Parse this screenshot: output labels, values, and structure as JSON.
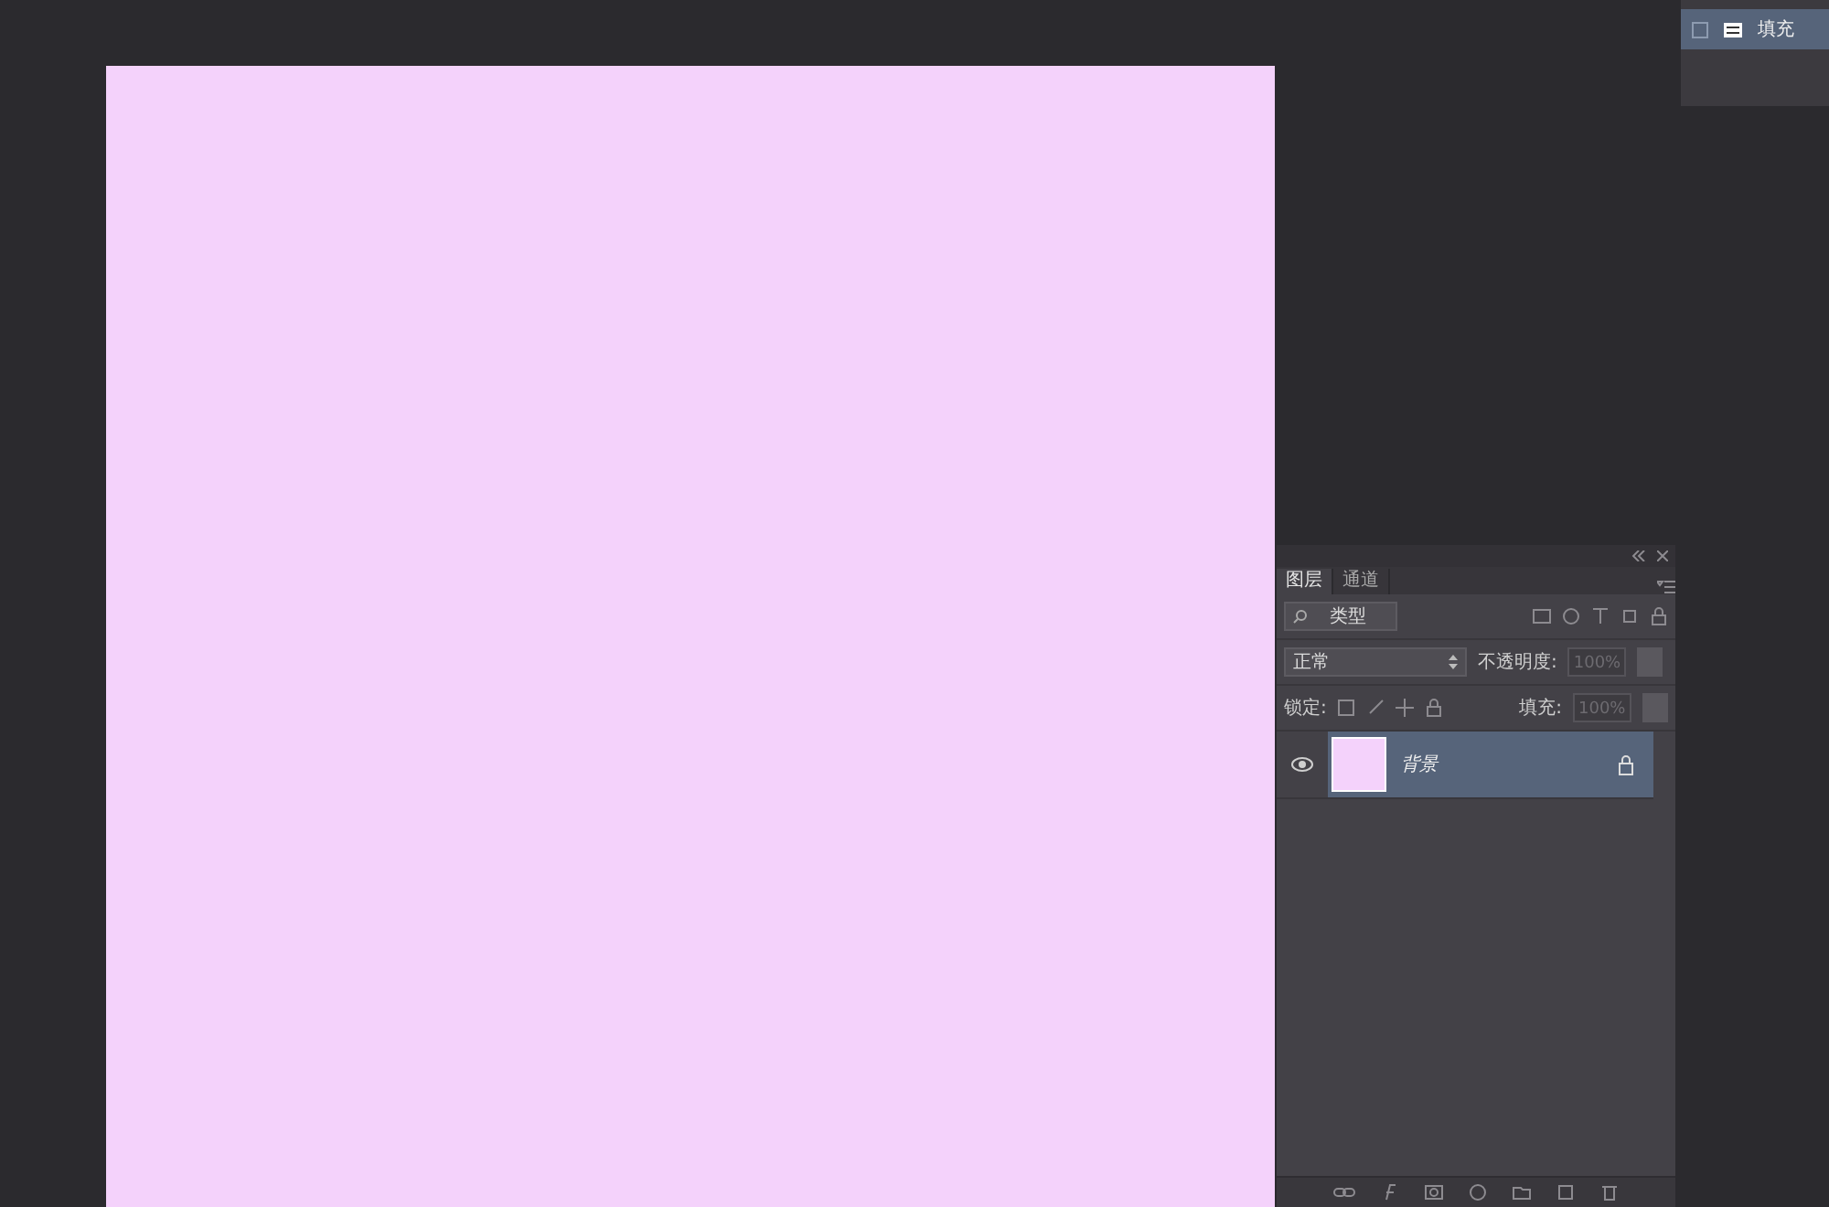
{
  "top_panel": {
    "label": "填充"
  },
  "tabs": [
    {
      "label": "图层",
      "selected": true
    },
    {
      "label": "通道",
      "selected": false
    }
  ],
  "filter": {
    "label": "类型"
  },
  "blend_mode": {
    "value": "正常"
  },
  "opacity": {
    "label": "不透明度:",
    "value": "100%",
    "disabled": true
  },
  "lock": {
    "label": "锁定:"
  },
  "fill": {
    "label": "填充:",
    "value": "100%",
    "disabled": true
  },
  "layers": [
    {
      "name": "背景",
      "visible": true,
      "selected": true,
      "locked": true
    }
  ]
}
